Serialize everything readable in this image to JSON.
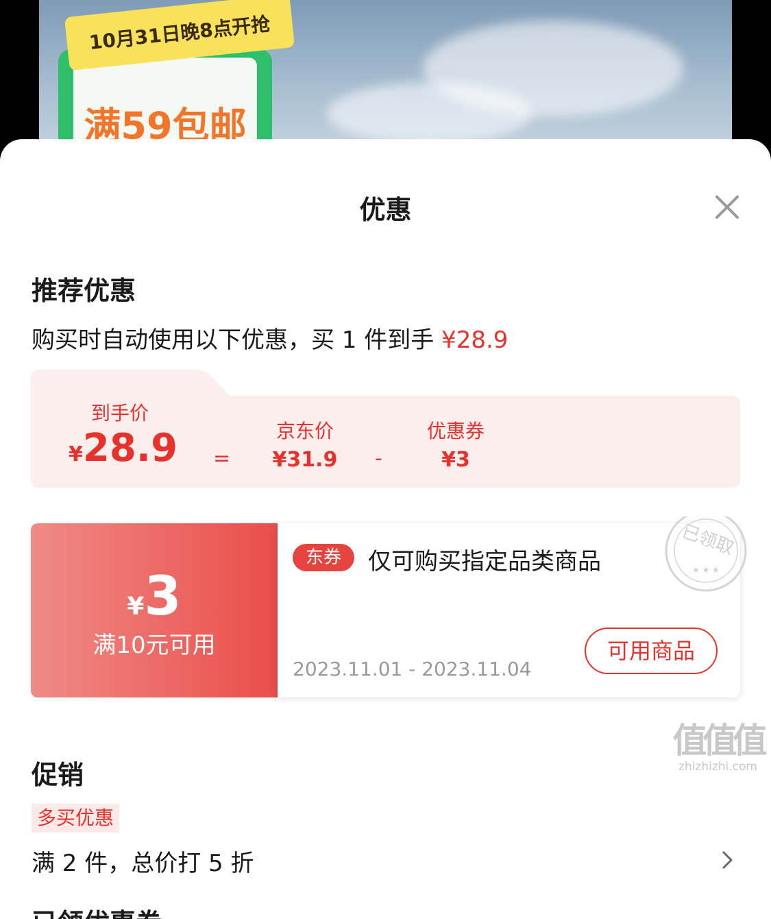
{
  "banner": {
    "date_badge": "10月31日晚8点开抢",
    "promo": "满59包邮"
  },
  "sheet": {
    "title": "优惠",
    "close_icon": "close-icon"
  },
  "recommended": {
    "heading": "推荐优惠",
    "description_prefix": "购买时自动使用以下优惠，买 1 件到手 ",
    "description_price": "¥28.9"
  },
  "price_breakdown": {
    "final_label": "到手价",
    "final_currency": "¥",
    "final_value": "28.9",
    "equals": "=",
    "jd_label": "京东价",
    "jd_value": "¥31.9",
    "minus": "-",
    "coupon_label": "优惠券",
    "coupon_value": "¥3"
  },
  "coupon": {
    "currency": "¥",
    "amount": "3",
    "condition": "满10元可用",
    "tag": "东券",
    "description": "仅可购买指定品类商品",
    "validity": "2023.11.01 - 2023.11.04",
    "button": "可用商品",
    "stamp": "已领取"
  },
  "promotion": {
    "heading": "促销",
    "tag": "多买优惠",
    "text": "满 2 件，总价打 5 折"
  },
  "claimed": {
    "heading": "已领优惠券"
  },
  "watermark": {
    "big": "值值值",
    "small": "zhizhizhi.com"
  },
  "colors": {
    "accent": "#e5322d",
    "price_box_bg": "#fdeeee"
  }
}
